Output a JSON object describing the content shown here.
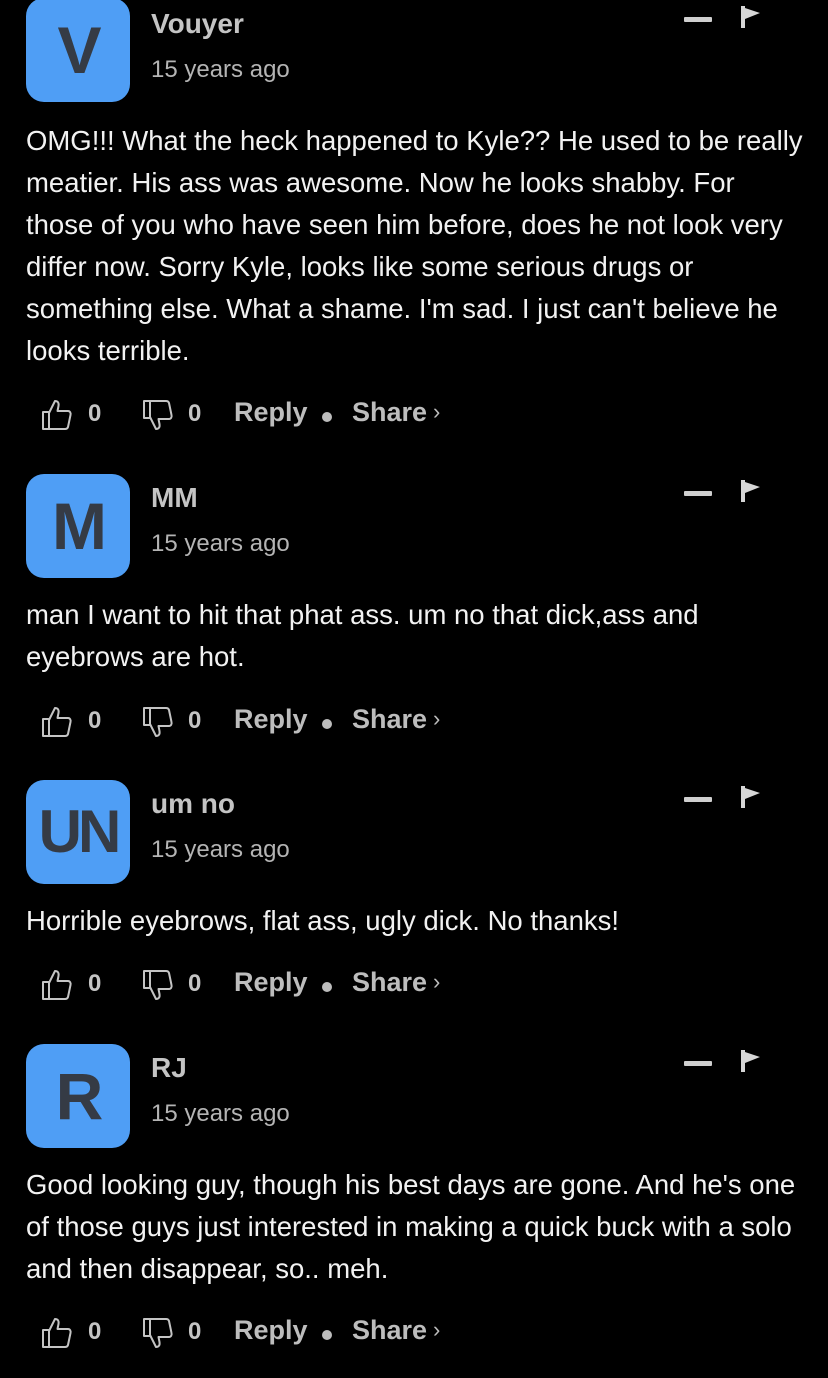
{
  "comments": [
    {
      "avatar_letter": "V",
      "author": "Vouyer",
      "time": "15 years ago",
      "text": "OMG!!! What the heck happened to Kyle?? He used to be really meatier. His ass was awesome. Now he looks shabby. For those of you who have seen him before, does he not look very differ now. Sorry Kyle, looks like some serious drugs or something else. What a shame. I'm sad. I just can't believe he looks terrible.",
      "likes": "0",
      "dislikes": "0",
      "reply_label": "Reply",
      "share_label": "Share",
      "share_chevron": "›"
    },
    {
      "avatar_letter": "M",
      "author": "MM",
      "time": "15 years ago",
      "text": "man I want to hit that phat ass. um no that dick,ass and eyebrows are hot.",
      "likes": "0",
      "dislikes": "0",
      "reply_label": "Reply",
      "share_label": "Share",
      "share_chevron": "›"
    },
    {
      "avatar_letter": "UN",
      "author": "um no",
      "time": "15 years ago",
      "text": "Horrible eyebrows, flat ass, ugly dick. No thanks!",
      "likes": "0",
      "dislikes": "0",
      "reply_label": "Reply",
      "share_label": "Share",
      "share_chevron": "›"
    },
    {
      "avatar_letter": "R",
      "author": "RJ",
      "time": "15 years ago",
      "text": "Good looking guy, though his best days are gone. And he's one of those guys just interested in making a quick buck with a solo and then disappear, so.. meh.",
      "likes": "0",
      "dislikes": "0",
      "reply_label": "Reply",
      "share_label": "Share",
      "share_chevron": "›"
    }
  ],
  "icons": {
    "collapse": "minus-icon",
    "report": "flag-icon",
    "like": "thumbs-up-icon",
    "dislike": "thumbs-down-icon"
  },
  "colors": {
    "background": "#000000",
    "avatar": "#4f9ef5",
    "avatar_letter": "#353b45",
    "text": "#f2f2f2",
    "muted": "#bdbdbd"
  }
}
